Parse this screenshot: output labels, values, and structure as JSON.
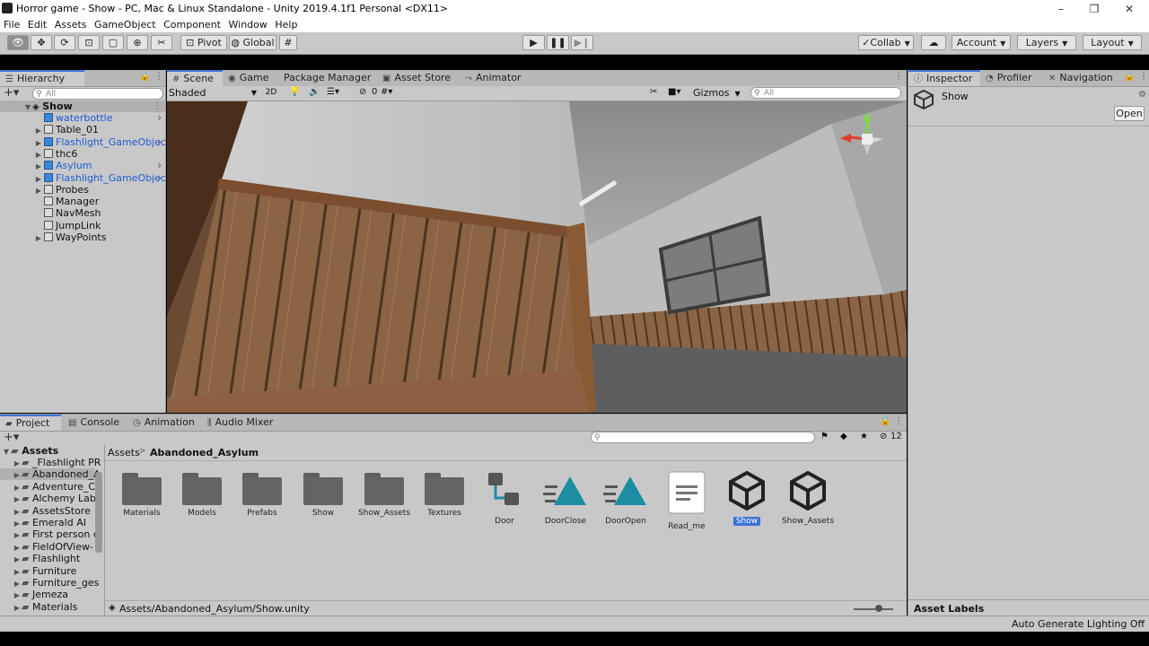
{
  "window": {
    "title": "Horror game - Show - PC, Mac & Linux Standalone - Unity 2019.4.1f1 Personal <DX11>",
    "minimize": "–",
    "maximize": "❐",
    "close": "✕"
  },
  "menu": [
    "File",
    "Edit",
    "Assets",
    "GameObject",
    "Component",
    "Window",
    "Help"
  ],
  "toolbar": {
    "pivot": "Pivot",
    "global": "Global",
    "collab": "Collab",
    "account": "Account",
    "layers": "Layers",
    "layout": "Layout"
  },
  "hierarchy": {
    "tab": "Hierarchy",
    "search_placeholder": "All",
    "scene": "Show",
    "items": [
      {
        "name": "waterbottle",
        "blue": true,
        "chevron": true,
        "expander": false
      },
      {
        "name": "Table_01",
        "blue": false,
        "chevron": false,
        "expander": true
      },
      {
        "name": "Flashlight_GameObjec",
        "blue": true,
        "chevron": true,
        "expander": true
      },
      {
        "name": "thc6",
        "blue": false,
        "chevron": false,
        "expander": true
      },
      {
        "name": "Asylum",
        "blue": true,
        "chevron": true,
        "expander": true
      },
      {
        "name": "Flashlight_GameObjec",
        "blue": true,
        "chevron": true,
        "expander": true
      },
      {
        "name": "Probes",
        "blue": false,
        "chevron": false,
        "expander": true
      },
      {
        "name": "Manager",
        "blue": false,
        "chevron": false,
        "expander": false
      },
      {
        "name": "NavMesh",
        "blue": false,
        "chevron": false,
        "expander": false
      },
      {
        "name": "JumpLink",
        "blue": false,
        "chevron": false,
        "expander": false
      },
      {
        "name": "WayPoints",
        "blue": false,
        "chevron": false,
        "expander": true
      }
    ]
  },
  "center_tabs": [
    "Scene",
    "Game",
    "Package Manager",
    "Asset Store",
    "Animator"
  ],
  "scene_bar": {
    "shading": "Shaded",
    "mode_2d": "2D",
    "hidden_count": "0",
    "gizmos": "Gizmos",
    "search_placeholder": "All"
  },
  "inspector": {
    "tabs": [
      "Inspector",
      "Profiler",
      "Navigation"
    ],
    "object_name": "Show",
    "open_button": "Open",
    "asset_labels": "Asset Labels"
  },
  "project": {
    "tabs": [
      "Project",
      "Console",
      "Animation",
      "Audio Mixer"
    ],
    "count": "12",
    "root": "Assets",
    "tree": [
      "_Flashlight PR",
      "Abandoned_A",
      "Adventure_Ch",
      "Alchemy Lab",
      "AssetsStore",
      "Emerald AI",
      "First person c",
      "FieldOfView-",
      "Flashlight",
      "Furniture",
      "Furniture_ges",
      "Jemeza",
      "Materials"
    ],
    "breadcrumb": [
      "Assets",
      "Abandoned_Asylum"
    ],
    "assets": [
      {
        "name": "Materials",
        "kind": "folder"
      },
      {
        "name": "Models",
        "kind": "folder"
      },
      {
        "name": "Prefabs",
        "kind": "folder"
      },
      {
        "name": "Show",
        "kind": "folder"
      },
      {
        "name": "Show_Assets",
        "kind": "folder"
      },
      {
        "name": "Textures",
        "kind": "folder"
      },
      {
        "name": "Door",
        "kind": "animator"
      },
      {
        "name": "DoorClose",
        "kind": "anim"
      },
      {
        "name": "DoorOpen",
        "kind": "anim"
      },
      {
        "name": "Read_me",
        "kind": "text"
      },
      {
        "name": "Show",
        "kind": "unity",
        "selected": true
      },
      {
        "name": "Show_Assets",
        "kind": "unity"
      }
    ],
    "path": "Assets/Abandoned_Asylum/Show.unity"
  },
  "status": {
    "text": "Auto Generate Lighting Off"
  },
  "colors": {
    "accent": "#3a72d8",
    "prefab_blue": "#1f5bd6",
    "teal": "#1b8ea3"
  }
}
